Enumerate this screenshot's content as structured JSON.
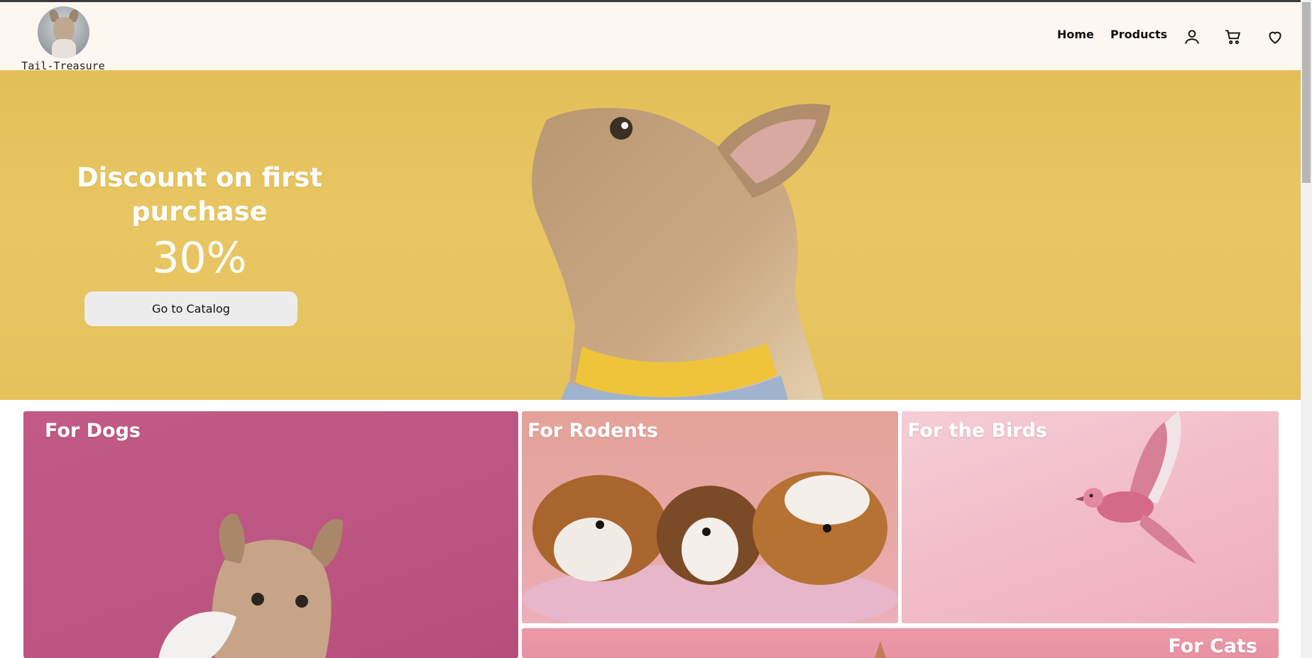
{
  "header": {
    "brand": "Tail-Treasure",
    "nav": {
      "home": "Home",
      "products": "Products"
    },
    "icons": [
      "user-icon",
      "cart-icon",
      "heart-icon"
    ]
  },
  "hero": {
    "title": "Discount on first purchase",
    "discount": "30%",
    "button": "Go to Catalog"
  },
  "categories": {
    "dogs": "For Dogs",
    "rodents": "For Rodents",
    "birds": "For the Birds",
    "cats": "For Cats"
  },
  "colors": {
    "header_bg": "#fdf7f1",
    "hero_bg": "#e5c25c",
    "dogs_tile": "#c25a87",
    "rodents_tile": "#e7a7a4",
    "birds_tile": "#f1b9c6",
    "cats_tile": "#ec9aa8"
  }
}
